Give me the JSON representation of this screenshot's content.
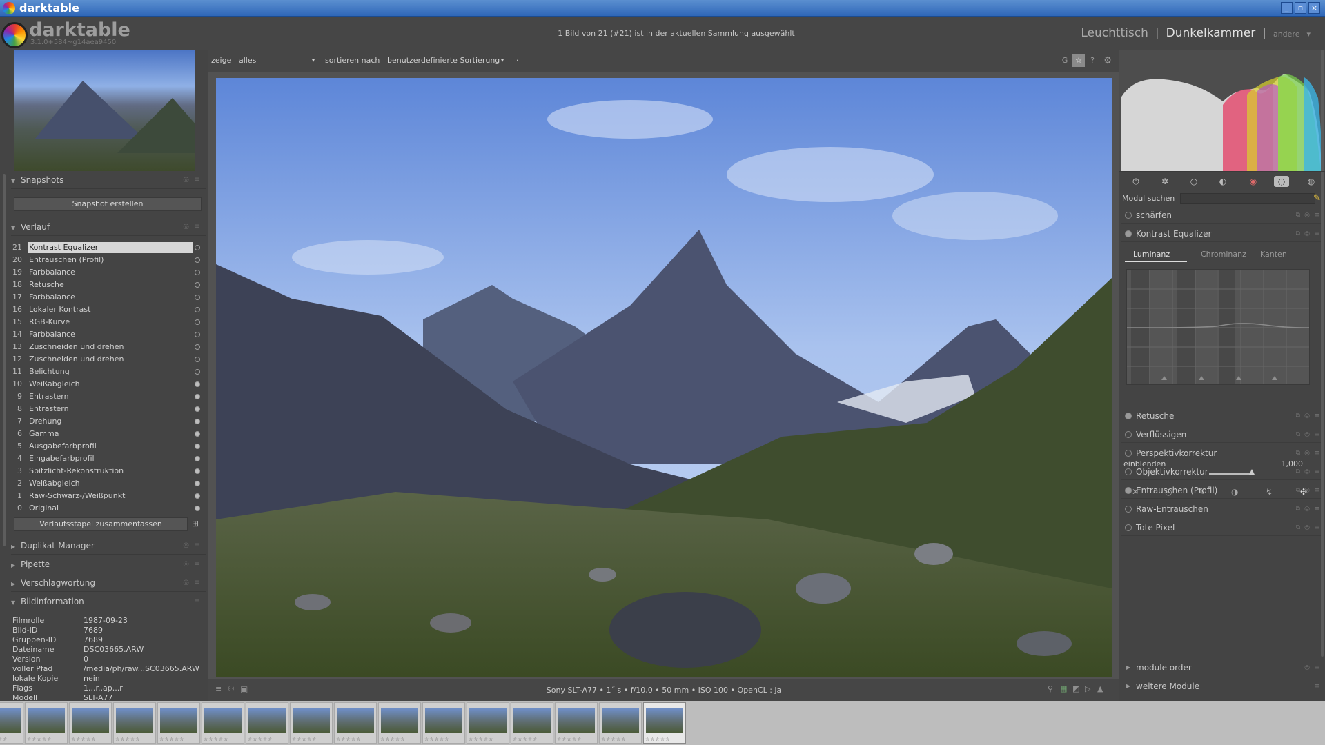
{
  "window": {
    "title": "darktable",
    "buttons": [
      "_",
      "▫",
      "×"
    ]
  },
  "header": {
    "app_name": "darktable",
    "version": "3.1.0+584~g14aea9450",
    "status": "1 Bild von 21 (#21) ist in der aktuellen Sammlung ausgewählt",
    "views": {
      "lighttable": "Leuchttisch",
      "sep1": "|",
      "darkroom": "Dunkelkammer",
      "sep2": "|",
      "other": "andere",
      "other_arrow": "▾"
    }
  },
  "toolbar": {
    "show_label": "zeige",
    "show_value": "alles",
    "show_arrow": "▾",
    "sort_label": "sortieren nach",
    "sort_value": "benutzerdefinierte Sortierung",
    "sort_arrow": "▾",
    "extra": "·",
    "grouping": "G",
    "star": "☆",
    "help": "?",
    "prefs": "⚙"
  },
  "left": {
    "snapshots": {
      "title": "Snapshots",
      "button": "Snapshot erstellen"
    },
    "history": {
      "title": "Verlauf",
      "items": [
        {
          "n": "21",
          "label": "Kontrast Equalizer"
        },
        {
          "n": "20",
          "label": "Entrauschen (Profil)"
        },
        {
          "n": "19",
          "label": "Farbbalance"
        },
        {
          "n": "18",
          "label": "Retusche"
        },
        {
          "n": "17",
          "label": "Farbbalance"
        },
        {
          "n": "16",
          "label": "Lokaler Kontrast"
        },
        {
          "n": "15",
          "label": "RGB-Kurve"
        },
        {
          "n": "14",
          "label": "Farbbalance"
        },
        {
          "n": "13",
          "label": "Zuschneiden und drehen"
        },
        {
          "n": "12",
          "label": "Zuschneiden und drehen"
        },
        {
          "n": "11",
          "label": "Belichtung"
        },
        {
          "n": "10",
          "label": "Weißabgleich"
        },
        {
          "n": "9",
          "label": "Entrastern"
        },
        {
          "n": "8",
          "label": "Entrastern"
        },
        {
          "n": "7",
          "label": "Drehung"
        },
        {
          "n": "6",
          "label": "Gamma"
        },
        {
          "n": "5",
          "label": "Ausgabefarbprofil"
        },
        {
          "n": "4",
          "label": "Eingabefarbprofil"
        },
        {
          "n": "3",
          "label": "Spitzlicht-Rekonstruktion"
        },
        {
          "n": "2",
          "label": "Weißabgleich"
        },
        {
          "n": "1",
          "label": "Raw-Schwarz-/Weißpunkt"
        },
        {
          "n": "0",
          "label": "Original"
        }
      ],
      "compress_button": "Verlaufsstapel zusammenfassen"
    },
    "duplicate": "Duplikat-Manager",
    "picker": "Pipette",
    "tagging": "Verschlagwortung",
    "info": {
      "title": "Bildinformation",
      "rows": [
        {
          "k": "Filmrolle",
          "v": "1987-09-23"
        },
        {
          "k": "Bild-ID",
          "v": "7689"
        },
        {
          "k": "Gruppen-ID",
          "v": "7689"
        },
        {
          "k": "Dateiname",
          "v": "DSC03665.ARW"
        },
        {
          "k": "Version",
          "v": "0"
        },
        {
          "k": "voller Pfad",
          "v": "/media/ph/raw...SC03665.ARW"
        },
        {
          "k": "lokale Kopie",
          "v": "nein"
        },
        {
          "k": "Flags",
          "v": "1...r..ap...r"
        },
        {
          "k": "Modell",
          "v": "SLT-A77"
        }
      ]
    }
  },
  "bottom_bar": {
    "exif": "Sony SLT-A77 • 1˝ s • f/10,0 • 50 mm • ISO 100 • OpenCL : ja"
  },
  "right": {
    "search_label": "Modul suchen",
    "modules_top": [
      {
        "name": "schärfen",
        "on": false
      },
      {
        "name": "Kontrast Equalizer",
        "on": true
      }
    ],
    "ce_tabs": {
      "t1": "Luminanz",
      "t2": "Chrominanz",
      "t3": "Kanten"
    },
    "blend": {
      "label": "einblenden",
      "value": "1,000"
    },
    "modules_bottom": [
      {
        "name": "Retusche",
        "on": true
      },
      {
        "name": "Verflüssigen",
        "on": false
      },
      {
        "name": "Perspektivkorrektur",
        "on": false
      },
      {
        "name": "Objektivkorrektur",
        "on": false
      },
      {
        "name": "Entrauschen (Profil)",
        "on": true
      },
      {
        "name": "Raw-Entrauschen",
        "on": false
      },
      {
        "name": "Tote Pixel",
        "on": false
      }
    ],
    "module_order": "module order",
    "more_modules": "weitere Module"
  },
  "filmstrip": {
    "count": 16,
    "current_index": 15
  }
}
